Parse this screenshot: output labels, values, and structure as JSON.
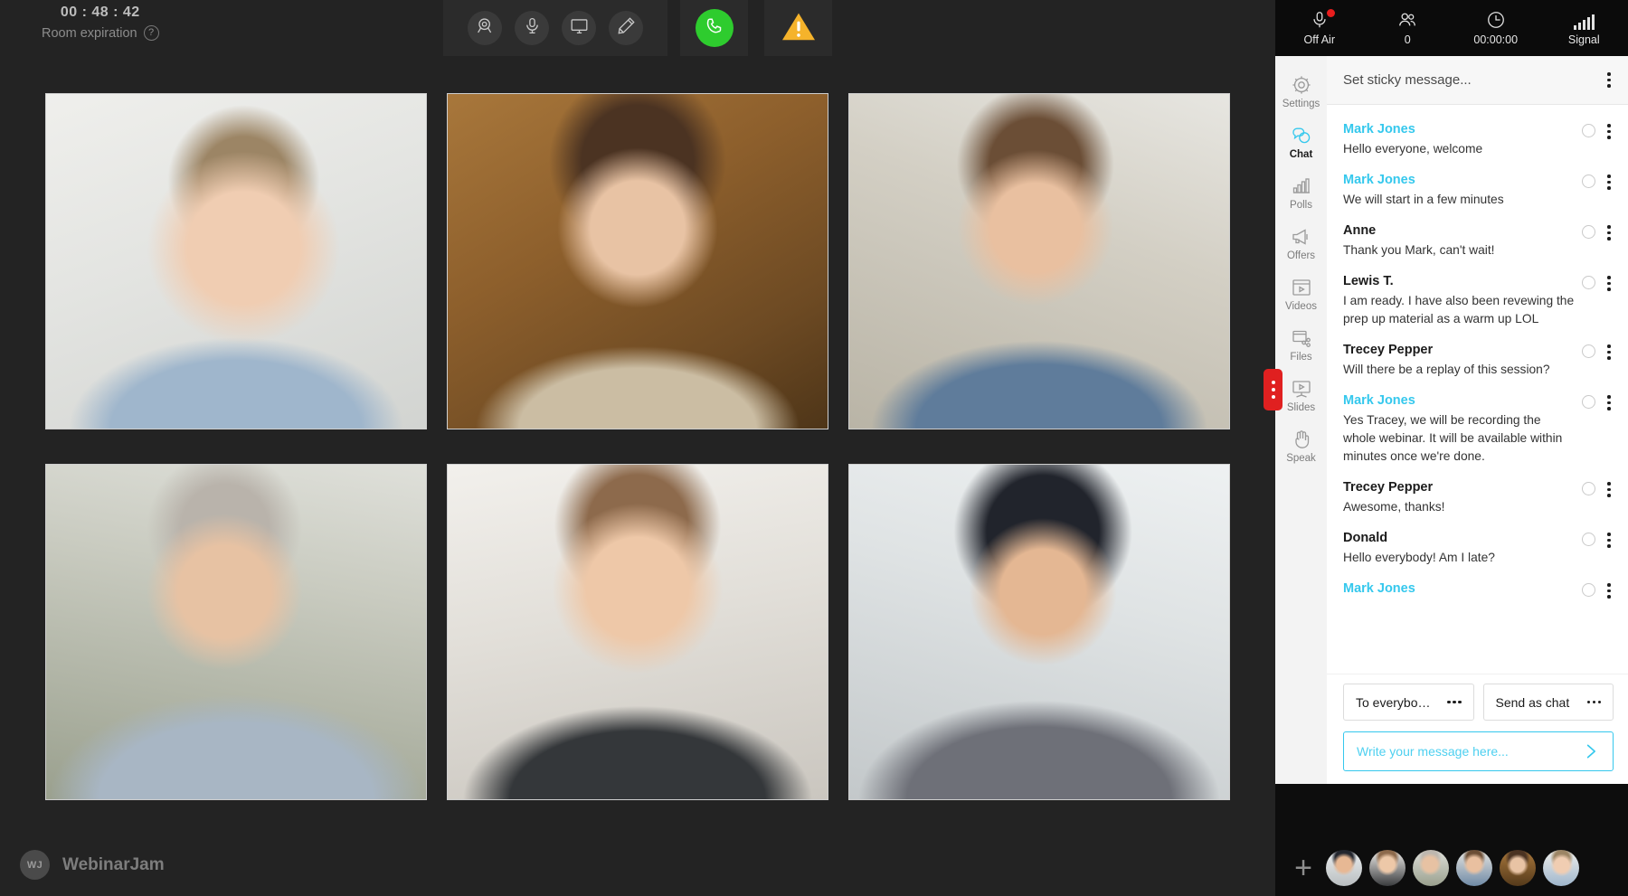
{
  "stage": {
    "timer": {
      "value": "00 : 48 : 42",
      "label": "Room expiration",
      "help": "?"
    },
    "toolbar": [
      {
        "name": "webcam",
        "label": "Webcam"
      },
      {
        "name": "microphone",
        "label": "Microphone"
      },
      {
        "name": "screen-share",
        "label": "Share screen"
      },
      {
        "name": "whiteboard",
        "label": "Whiteboard"
      }
    ],
    "call_button": {
      "label": "Start call",
      "color": "#2ecc2e"
    },
    "warning_button": {
      "label": "Warning",
      "color": "#f5b32b"
    },
    "brand": {
      "initials": "WJ",
      "name": "WebinarJam"
    },
    "participants": [
      {
        "name": "participant-1"
      },
      {
        "name": "participant-2"
      },
      {
        "name": "participant-3"
      },
      {
        "name": "participant-4"
      },
      {
        "name": "participant-5"
      },
      {
        "name": "participant-6"
      }
    ]
  },
  "panel": {
    "status": [
      {
        "icon": "microphone-icon",
        "text": "Off Air",
        "badge": true
      },
      {
        "icon": "people-icon",
        "text": "0",
        "badge": false
      },
      {
        "icon": "clock-icon",
        "text": "00:00:00",
        "badge": false
      },
      {
        "icon": "signal-icon",
        "text": "Signal",
        "badge": false
      }
    ],
    "nav": [
      {
        "icon": "gear-icon",
        "label": "Settings",
        "active": false
      },
      {
        "icon": "chat-bubbles-icon",
        "label": "Chat",
        "active": true
      },
      {
        "icon": "bar-chart-icon",
        "label": "Polls",
        "active": false
      },
      {
        "icon": "megaphone-icon",
        "label": "Offers",
        "active": false
      },
      {
        "icon": "video-clip-icon",
        "label": "Videos",
        "active": false
      },
      {
        "icon": "file-share-icon",
        "label": "Files",
        "active": false
      },
      {
        "icon": "presentation-icon",
        "label": "Slides",
        "active": false
      },
      {
        "icon": "hand-icon",
        "label": "Speak",
        "active": false
      }
    ],
    "sticky": {
      "text": "Set sticky message..."
    },
    "messages": [
      {
        "author": "Mark Jones",
        "host": true,
        "text": "Hello everyone, welcome"
      },
      {
        "author": "Mark Jones",
        "host": true,
        "text": "We will start in a few minutes"
      },
      {
        "author": "Anne",
        "host": false,
        "text": "Thank you Mark, can't wait!"
      },
      {
        "author": "Lewis T.",
        "host": false,
        "text": "I am ready. I have also been revewing the prep up material as a warm up LOL"
      },
      {
        "author": "Trecey Pepper",
        "host": false,
        "text": "Will there be a replay of this session?"
      },
      {
        "author": "Mark Jones",
        "host": true,
        "text": "Yes Tracey, we will be recording the whole webinar. It will be available within minutes once we're done."
      },
      {
        "author": "Trecey Pepper",
        "host": false,
        "text": "Awesome, thanks!"
      },
      {
        "author": "Donald",
        "host": false,
        "text": "Hello everybody! Am I late?"
      },
      {
        "author": "Mark Jones",
        "host": true,
        "text": ""
      }
    ],
    "composer": {
      "recipient_label": "To everybo…",
      "mode_label": "Send as chat",
      "input_placeholder": "Write your message here...",
      "input_value": "",
      "send_icon": "send-chevron-icon"
    },
    "add_button": "+",
    "collapse_handle": "panel-collapse-handle"
  },
  "colors": {
    "accent": "#35c8ed",
    "call_green": "#2ecc2e",
    "warning_amber": "#f5b32b",
    "collapse_red": "#e02020",
    "stage_bg": "#232323",
    "panel_bg": "#0d0d0d"
  }
}
